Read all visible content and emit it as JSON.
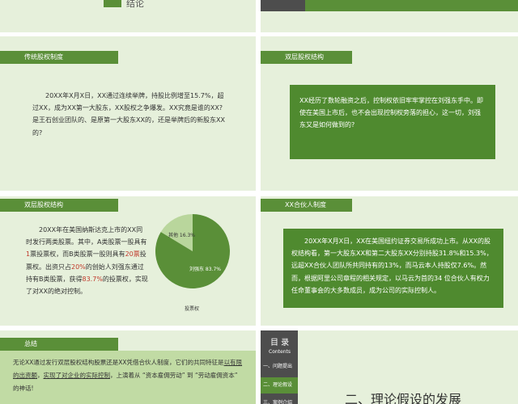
{
  "slide1": {
    "title": "结论"
  },
  "slide3": {
    "header": "传统股权制度",
    "body": "20XX年X月X日，XX通过连续举牌，持股比例增至15.7%，超过XX，成为XX第一大股东，XX股权之争爆发。XX究竟是谁的XX?是王石创业团队的、是原第一大股东XX的，还是举牌后的新股东XX的?"
  },
  "slide4": {
    "header": "双层股权结构",
    "body": "XX经历了数轮融资之后，控制权依旧牢牢掌控在刘强东手中。即使在美国上市后，也不会出现控制权旁落的担心，这一切，刘强东又是如何做到的?"
  },
  "slide5": {
    "header": "双层股权结构",
    "p1": "20XX年在美国纳斯达克上市的XX同时发行两类股票。其中，A类股票一股具有",
    "red1": "1",
    "p2": "票投票权，而B类股票一股则具有",
    "red2": "20票",
    "p3": "投票权。出资只占",
    "red3": "20%",
    "p4": "的创始人刘强东通过持有B类股票，获得",
    "red4": "83.7%",
    "p5": "的投票权，实现了对XX的绝对控制。",
    "chart_data": {
      "type": "pie",
      "categories": [
        "刘强东",
        "其他"
      ],
      "values": [
        83.7,
        16.3
      ],
      "labels": [
        "刘强东 83.7%",
        "其他 16.3%"
      ],
      "title": "投票权",
      "colors": [
        "#5a8f38",
        "#b9d69c"
      ]
    }
  },
  "slide6": {
    "header": "XX合伙人制度",
    "body": "20XX年X月X日，XX在美国纽约证券交易所成功上市。从XX的股权结构看，第一大股东XX和第二大股东XX分别持股31.8%和15.3%，远超XX合伙人团队所共同持有的13%，而马云本人持股仅7.6%。然而，根据阿里公司章程的相关规定，以马云为首的34 位合伙人有权力任命董事会的大多数成员，成为公司的实际控制人。"
  },
  "slide7": {
    "header": "总结",
    "p1": "无论XX通过发行双层股权结构股票还是XX凭借合伙人制度，它们的共同特征是",
    "u1": "以有限的出资额",
    "p2": "，",
    "u2": "实现了对企业的实际控制",
    "p3": "，上演着从 “资本雇佣劳动” 到 “劳动雇佣资本” 的神话!"
  },
  "slide8": {
    "title": "目 录",
    "subtitle": "Contents",
    "items": [
      "一、问题提出",
      "二、理论假设",
      "三、案例介绍"
    ],
    "big_title": "二、理论假设的发展"
  }
}
